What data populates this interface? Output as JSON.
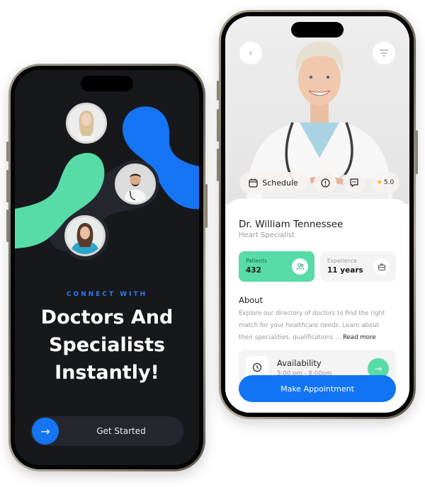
{
  "colors": {
    "accent_blue": "#1575f5",
    "accent_green": "#57dba7",
    "dark_bg": "#17181c",
    "pill_bg": "#25272e"
  },
  "onboarding": {
    "eyebrow": "CONNECT WITH",
    "headline_lines": [
      "Doctors And",
      "Specialists",
      "Instantly!"
    ],
    "cta_icon": "arrow-right-icon",
    "cta_label": "Get Started",
    "avatars": [
      {
        "name": "avatar-woman-blonde"
      },
      {
        "name": "avatar-male-doctor"
      },
      {
        "name": "avatar-female-nurse"
      }
    ]
  },
  "profile": {
    "back_icon": "chevron-left-icon",
    "filter_icon": "filter-icon",
    "chips": {
      "schedule_label": "Schedule",
      "rating": "5.0"
    },
    "doctor_name": "Dr. William Tennessee",
    "specialty": "Heart Specialist",
    "stats": [
      {
        "label": "Patients",
        "value": "432",
        "icon": "users-icon"
      },
      {
        "label": "Experience",
        "value": "11 years",
        "icon": "briefcase-icon"
      }
    ],
    "about_title": "About",
    "about_text": "Explore our directory of doctors to find the right match for your healthcare needs. Learn about their specialities, qualifications ...",
    "read_more": "Read more",
    "availability": {
      "title": "Availability",
      "time": "5:00 pm - 8:00pm"
    },
    "appointment_label": "Make Appointment"
  }
}
